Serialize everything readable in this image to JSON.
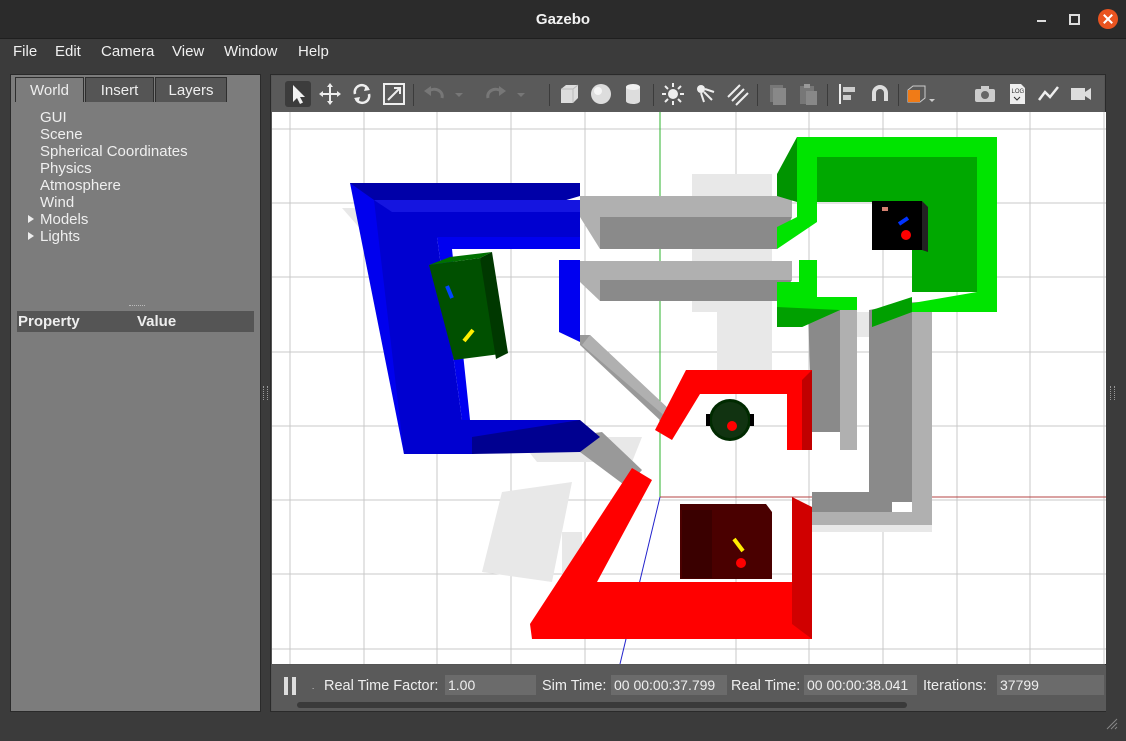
{
  "window": {
    "title": "Gazebo"
  },
  "menu": [
    {
      "label": "File"
    },
    {
      "label": "Edit"
    },
    {
      "label": "Camera"
    },
    {
      "label": "View"
    },
    {
      "label": "Window"
    },
    {
      "label": "Help"
    }
  ],
  "left_panel": {
    "tabs": [
      {
        "label": "World",
        "active": true
      },
      {
        "label": "Insert"
      },
      {
        "label": "Layers"
      }
    ],
    "tree": [
      {
        "label": "GUI"
      },
      {
        "label": "Scene"
      },
      {
        "label": "Spherical Coordinates"
      },
      {
        "label": "Physics"
      },
      {
        "label": "Atmosphere"
      },
      {
        "label": "Wind"
      },
      {
        "label": "Models",
        "expandable": true
      },
      {
        "label": "Lights",
        "expandable": true
      }
    ],
    "property_header": {
      "property": "Property",
      "value": "Value"
    }
  },
  "toolbar": {
    "tools": [
      "select-icon",
      "translate-icon",
      "rotate-icon",
      "scale-icon",
      "undo-icon",
      "undo-history-icon",
      "redo-icon",
      "redo-history-icon",
      "box-icon",
      "sphere-icon",
      "cylinder-icon",
      "point-light-icon",
      "spot-light-icon",
      "directional-light-icon",
      "copy-icon",
      "paste-icon",
      "align-icon",
      "snap-icon",
      "view-angle-icon",
      "screenshot-icon",
      "log-icon",
      "plot-icon",
      "record-video-icon"
    ]
  },
  "status": {
    "real_time_factor_label": "Real Time Factor:",
    "real_time_factor": "1.00",
    "sim_time_label": "Sim Time:",
    "sim_time": "00 00:00:37.799",
    "real_time_label": "Real Time:",
    "real_time": "00 00:00:38.041",
    "iterations_label": "Iterations:",
    "iterations": "37799"
  },
  "colors": {
    "blue_wall": "#0000ee",
    "green_wall": "#00dd00",
    "red_wall": "#ff0000",
    "grey_wall": "#a6a6a6",
    "accent": "#e95420"
  }
}
